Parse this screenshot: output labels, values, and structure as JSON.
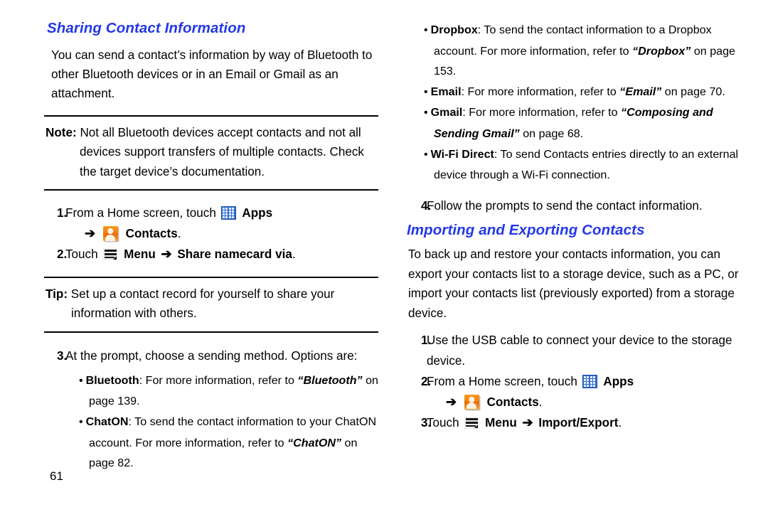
{
  "page": {
    "number": "61"
  },
  "left_column": {
    "heading": "Sharing Contact Information",
    "intro_paragraph": "You can send a contact’s information by way of Bluetooth to other Bluetooth devices or in an Email or Gmail as an attachment.",
    "note": {
      "label": "Note:",
      "text": "Not all Bluetooth devices accept contacts and not all devices support transfers of multiple contacts. Check the target device’s documentation."
    },
    "steps": [
      {
        "number": "1.",
        "line1_prefix": "From a Home screen, touch",
        "apps_label": "Apps",
        "arrow": "➔",
        "contacts_label": "Contacts",
        "line2_suffix": "."
      },
      {
        "number": "2.",
        "prefix": "Touch",
        "menu_label": "Menu",
        "arrow": "➔",
        "target_label": "Share namecard via",
        "suffix": "."
      }
    ],
    "tip": {
      "label": "Tip:",
      "text": "Set up a contact record for yourself to share your information with others."
    },
    "step3": {
      "number": "3.",
      "text": "At the prompt, choose a sending method. Options are:"
    },
    "options": [
      {
        "term": "Bluetooth",
        "text_before": ": For more information, refer to ",
        "xref": "“Bluetooth”",
        "text_after": " on page 139."
      },
      {
        "term": "ChatON",
        "text_before": ": To send the contact information to your ChatON account. For more information, refer to ",
        "xref": "“ChatON”",
        "text_after": " on page 82."
      }
    ]
  },
  "right_column": {
    "options": [
      {
        "term": "Dropbox",
        "text_before": ": To send the contact information to a Dropbox account. For more information, refer to ",
        "xref": "“Dropbox”",
        "text_after": " on page 153."
      },
      {
        "term": "Email",
        "text_before": ": For more information, refer to ",
        "xref": "“Email”",
        "text_after": " on page 70."
      },
      {
        "term": "Gmail",
        "text_before": ": For more information, refer to ",
        "xref": "“Composing and Sending Gmail”",
        "text_after": " on page 68."
      },
      {
        "term": "Wi-Fi Direct",
        "text_before": ": To send Contacts entries directly to an external device through a Wi-Fi connection.",
        "xref": "",
        "text_after": ""
      }
    ],
    "step4": {
      "number": "4.",
      "text": "Follow the prompts to send the contact information."
    },
    "heading": "Importing and Exporting Contacts",
    "intro_paragraph": "To back up and restore your contacts information, you can export your contacts list to a storage device, such as a PC, or import your contacts list (previously exported) from a storage device.",
    "steps": [
      {
        "number": "1.",
        "text": "Use the USB cable to connect your device to the storage device."
      },
      {
        "number": "2.",
        "line1_prefix": "From a Home screen, touch",
        "apps_label": "Apps",
        "arrow": "➔",
        "contacts_label": "Contacts",
        "line2_suffix": "."
      },
      {
        "number": "3.",
        "prefix": "Touch",
        "menu_label": "Menu",
        "arrow": "➔",
        "target_label": "Import/Export",
        "suffix": "."
      }
    ]
  },
  "icons": {
    "apps": "apps-grid-icon",
    "contacts": "contacts-person-icon",
    "menu": "menu-hamburger-icon"
  },
  "colors": {
    "heading_blue": "#2438e8",
    "apps_icon_blue": "#2f6fd0",
    "contacts_icon_orange": "#f07c14",
    "text_black": "#000000"
  }
}
